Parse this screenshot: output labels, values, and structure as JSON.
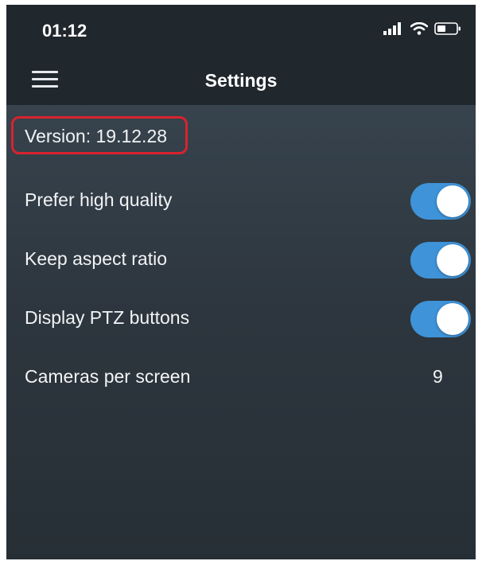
{
  "status_bar": {
    "time": "01:12",
    "icons": [
      "cellular-signal-icon",
      "wifi-icon",
      "battery-icon"
    ]
  },
  "nav_bar": {
    "menu_icon": "hamburger-menu-icon",
    "title": "Settings"
  },
  "settings": {
    "version": "Version: 19.12.28",
    "items": [
      {
        "label": "Prefer high quality",
        "type": "toggle",
        "state": "on"
      },
      {
        "label": "Keep aspect ratio",
        "type": "toggle",
        "state": "on"
      },
      {
        "label": "Display PTZ buttons",
        "type": "toggle",
        "state": "on"
      },
      {
        "label": "Cameras per screen",
        "type": "value",
        "value": "9"
      }
    ]
  },
  "colors": {
    "background": "#2b333a",
    "header": "#20272d",
    "toggle_on": "#3f93d8",
    "highlight_border": "#d8232f",
    "text": "#f2f4f6"
  }
}
